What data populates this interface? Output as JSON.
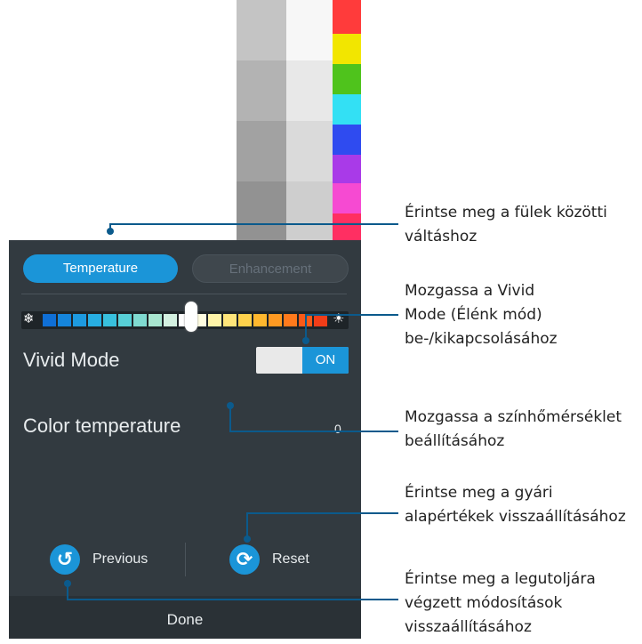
{
  "tabs": [
    {
      "label": "Temperature",
      "active": true
    },
    {
      "label": "Enhancement",
      "active": false
    }
  ],
  "vivid_mode": {
    "label": "Vivid Mode",
    "toggle_state": "ON"
  },
  "color_temperature": {
    "label": "Color temperature",
    "value": "0",
    "level": 0.5
  },
  "slider_icons": {
    "cold": "snowflake-icon",
    "warm": "sun-icon"
  },
  "buttons": {
    "previous": "Previous",
    "reset": "Reset",
    "done": "Done"
  },
  "callouts": [
    {
      "text": "Érintse meg a fülek közötti váltáshoz"
    },
    {
      "text": "Mozgassa a Vivid Mode (Élénk mód) be-/kikapcsolásához"
    },
    {
      "text": "Mozgassa a színhőmérséklet beállításához"
    },
    {
      "text": "Érintse meg a gyári alapértékek visszaállításához"
    },
    {
      "text": "Érintse meg a legutoljára végzett módosítások visszaállításához"
    }
  ],
  "colors": {
    "accent": "#1b95d8",
    "panel_bg": "#323a40",
    "callout_line": "#0b5a8c"
  }
}
